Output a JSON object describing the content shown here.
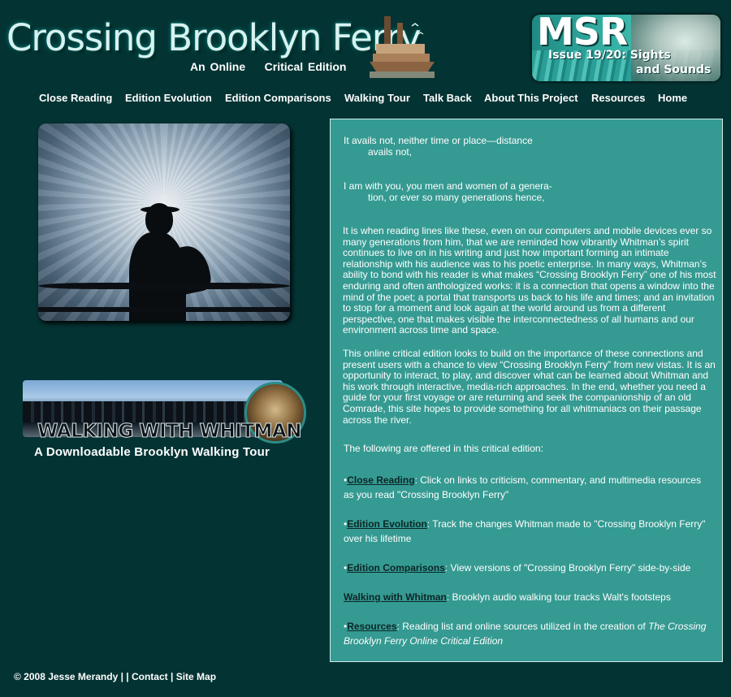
{
  "header": {
    "title": "Crossing Brooklyn Ferry",
    "subtitle": "An Online    Critical Edition",
    "badge": {
      "letters": "MSR",
      "issue_line1": "Issue 19/20: Sights",
      "issue_line2": "and Sounds"
    }
  },
  "nav": {
    "items": [
      {
        "label": "Close Reading"
      },
      {
        "label": "Edition Evolution"
      },
      {
        "label": "Edition Comparisons"
      },
      {
        "label": "Walking Tour"
      },
      {
        "label": "Talk Back"
      },
      {
        "label": "About This Project"
      },
      {
        "label": "Resources"
      },
      {
        "label": "Home"
      }
    ]
  },
  "tour_banner": {
    "title": "WALKING WITH WHITMAN",
    "subtitle": "A Downloadable Brooklyn Walking Tour"
  },
  "content": {
    "poem1_line1": "It avails not, neither time or place—distance",
    "poem1_line2": "avails not,",
    "poem2_line1": "I am with you, you men and women of a genera-",
    "poem2_line2": "tion, or ever so many generations hence,",
    "para1": "It is when reading lines like these, even on our computers and mobile devices ever so many generations from him, that we are reminded how vibrantly Whitman’s spirit continues to live on in his writing and just how important forming an intimate relationship with his audience was to his poetic enterprise. In many ways, Whitman’s ability to bond with his reader is what makes “Crossing Brooklyn Ferry” one of his most enduring and often anthologized works: it is a connection that opens a window into the mind of the poet; a portal that transports us back to his life and times; and an invitation to stop for a moment and look again at the world around us from a different perspective, one that makes visible the interconnectedness of all humans and our environment across time and space.",
    "para2": "This online critical edition looks to build on the importance of these connections and present users with a chance to view “Crossing Brooklyn Ferry” from new vistas.  It is an opportunity to interact, to play, and discover what can be learned about Whitman and his work through interactive, media-rich approaches. In the end, whether you need a guide for your first voyage or are returning and seek the companionship of an old Comrade, this site hopes to provide something for all whitmaniacs on their passage across the river.",
    "offered_intro": "The following are offered in this critical edition:",
    "features": [
      {
        "bullet": "•",
        "term": "Close Reading",
        "desc": ": Click on links to criticism, commentary, and multimedia resources as you read \"Crossing Brooklyn Ferry\""
      },
      {
        "bullet": "•",
        "term": "Edition Evolution",
        "desc": ": Track the changes Whitman made to \"Crossing Brooklyn Ferry\" over his lifetime"
      },
      {
        "bullet": "•",
        "term": "Edition Comparisons",
        "desc": ": View versions of \"Crossing Brooklyn Ferry\" side-by-side"
      },
      {
        "bullet": "",
        "term": "Walking with Whitman",
        "desc": ": Brooklyn audio walking tour tracks Walt's footsteps"
      },
      {
        "bullet": "•",
        "term": "Resources",
        "desc": ": Reading list and online sources utilized in the creation of ",
        "desc_italic": "The Crossing Brooklyn Ferry Online Critical Edition"
      }
    ]
  },
  "footer": {
    "copyright": "© 2008 Jesse Merandy | |",
    "contact": "Contact",
    "separator": "|",
    "sitemap": "Site Map"
  }
}
